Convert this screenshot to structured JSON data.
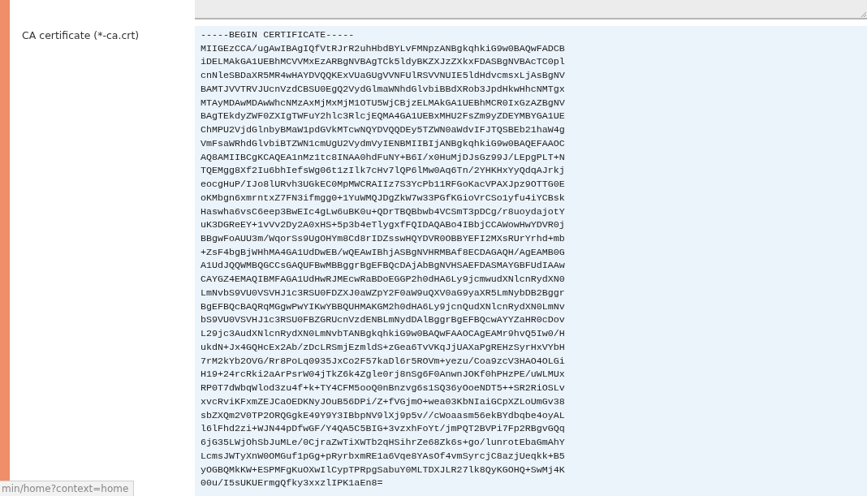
{
  "field": {
    "label": "CA certificate (*-ca.crt)",
    "lines": [
      "-----BEGIN CERTIFICATE-----",
      "MIIGEzCCA/ugAwIBAgIQfVtRJrR2uhHbdBYLvFMNpzANBgkqhkiG9w0BAQwFADCB",
      "iDELMAkGA1UEBhMCVVMxEzARBgNVBAgTCk5ldyBKZXJzZXkxFDASBgNVBAcTC0pl",
      "cnNleSBDaXR5MR4wHAYDVQQKExVUaGUgVVNFUlRSVVNUIE5ldHdvcmsxLjAsBgNV",
      "BAMTJVVTRVJUcnVzdCBSU0EgQ2VydGlmaWNhdGlvbiBBdXRob3JpdHkwHhcNMTgx",
      "MTAyMDAwMDAwWhcNMzAxMjMxMjM1OTU5WjCBjzELMAkGA1UEBhMCR0IxGzAZBgNV",
      "BAgTEkdyZWF0ZXIgTWFuY2hlc3RlcjEQMA4GA1UEBxMHU2FsZm9yZDEYMBYGA1UE",
      "ChMPU2VjdGlnbyBMaW1pdGVkMTcwNQYDVQQDEy5TZWN0aWdvIFJTQSBEb21haW4g",
      "VmFsaWRhdGlvbiBTZWN1cmUgU2VydmVyIENBMIIBIjANBgkqhkiG9w0BAQEFAAOC",
      "AQ8AMIIBCgKCAQEA1nMz1tc8INAA0hdFuNY+B6I/x0HuMjDJsGz99J/LEpgPLT+N",
      "TQEMgg8Xf2Iu6bhIefsWg06t1zIlk7cHv7lQP6lMw0Aq6Tn/2YHKHxYyQdqAJrkj",
      "eocgHuP/IJo8lURvh3UGkEC0MpMWCRAIIz7S3YcPb11RFGoKacVPAXJpz9OTTG0E",
      "oKMbgn6xmrntxZ7FN3ifmgg0+1YuWMQJDgZkW7w33PGfKGioVrCSo1yfu4iYCBsk",
      "Haswha6vsC6eep3BwEIc4gLw6uBK0u+QDrTBQBbwb4VCSmT3pDCg/r8uoydajotY",
      "uK3DGReEY+1vVv2Dy2A0xHS+5p3b4eTlygxfFQIDAQABo4IBbjCCAWowHwYDVR0j",
      "BBgwFoAUU3m/WqorSs9UgOHYm8Cd8rIDZsswHQYDVR0OBBYEFI2MXsRUrYrhd+mb",
      "+ZsF4bgBjWHhMA4GA1UdDwEB/wQEAwIBhjASBgNVHRMBAf8ECDAGAQH/AgEAMB0G",
      "A1UdJQQWMBQGCCsGAQUFBwMBBggrBgEFBQcDAjAbBgNVHSAEFDASMAYGBFUdIAAw",
      "CAYGZ4EMAQIBMFAGA1UdHwRJMEcwRaBDoEGGP2h0dHA6Ly9jcmwudXNlcnRydXN0",
      "LmNvbS9VU0VSVHJ1c3RSU0FDZXJ0aWZpY2F0aW9uQXV0aG9yaXR5LmNybDB2Bggr",
      "BgEFBQcBAQRqMGgwPwYIKwYBBQUHMAKGM2h0dHA6Ly9jcnQudXNlcnRydXN0LmNv",
      "bS9VU0VSVHJ1c3RSU0FBZGRUcnVzdENBLmNydDAlBggrBgEFBQcwAYYZaHR0cDov",
      "L29jc3AudXNlcnRydXN0LmNvbTANBgkqhkiG9w0BAQwFAAOCAgEAMr9hvQ5Iw0/H",
      "ukdN+Jx4GQHcEx2Ab/zDcLRSmjEzmldS+zGea6TvVKqJjUAXaPgREHzSyrHxVYbH",
      "7rM2kYb2OVG/Rr8PoLq0935JxCo2F57kaDl6r5ROVm+yezu/Coa9zcV3HAO4OLGi",
      "H19+24rcRki2aArPsrW04jTkZ6k4Zgle0rj8nSg6F0AnwnJOKf0hPHzPE/uWLMUx",
      "RP0T7dWbqWlod3zu4f+k+TY4CFM5ooQ0nBnzvg6s1SQ36yOoeNDT5++SR2RiOSLv",
      "xvcRviKFxmZEJCaOEDKNyJOuB56DPi/Z+fVGjmO+wea03KbNIaiGCpXZLoUmGv38",
      "sbZXQm2V0TP2ORQGgkE49Y9Y3IBbpNV9lXj9p5v//cWoaasm56ekBYdbqbe4oyAL",
      "l6lFhd2zi+WJN44pDfwGF/Y4QA5C5BIG+3vzxhFoYt/jmPQT2BVPi7Fp2RBgvGQq",
      "6jG35LWjOhSbJuMLe/0CjraZwTiXWTb2qHSihrZe68Zk6s+go/lunrotEbaGmAhY",
      "LcmsJWTyXnW0OMGuf1pGg+pRyrbxmRE1a6Vqe8YAsOf4vmSyrcjC8azjUeqkk+B5",
      "yOGBQMkKW+ESPMFgKuOXwIlCypTPRpgSabuY0MLTDXJLR27lk8QyKGOHQ+SwMj4K",
      "00u/I5sUKUErmgQfky3xxzlIPK1aEn8="
    ]
  },
  "status_url": "min/home?context=home"
}
